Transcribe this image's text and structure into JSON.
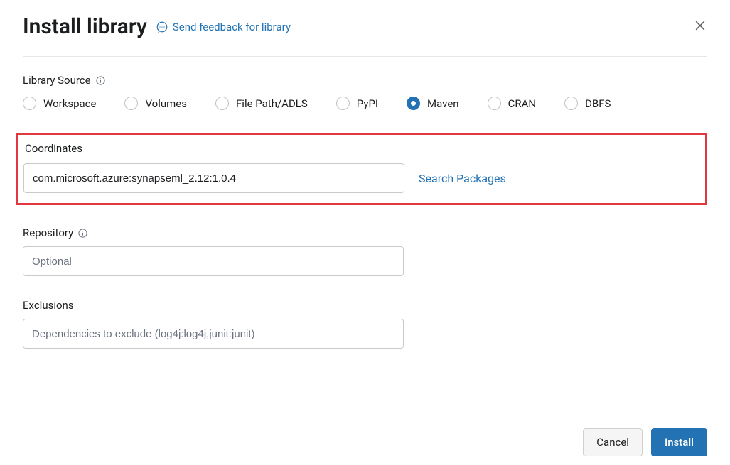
{
  "header": {
    "title": "Install library",
    "feedback_label": "Send feedback for library"
  },
  "source": {
    "label": "Library Source",
    "options": [
      "Workspace",
      "Volumes",
      "File Path/ADLS",
      "PyPI",
      "Maven",
      "CRAN",
      "DBFS"
    ],
    "selected": "Maven"
  },
  "coordinates": {
    "label": "Coordinates",
    "value": "com.microsoft.azure:synapseml_2.12:1.0.4",
    "search_link": "Search Packages"
  },
  "repository": {
    "label": "Repository",
    "placeholder": "Optional",
    "value": ""
  },
  "exclusions": {
    "label": "Exclusions",
    "placeholder": "Dependencies to exclude (log4j:log4j,junit:junit)",
    "value": ""
  },
  "footer": {
    "cancel": "Cancel",
    "install": "Install"
  }
}
